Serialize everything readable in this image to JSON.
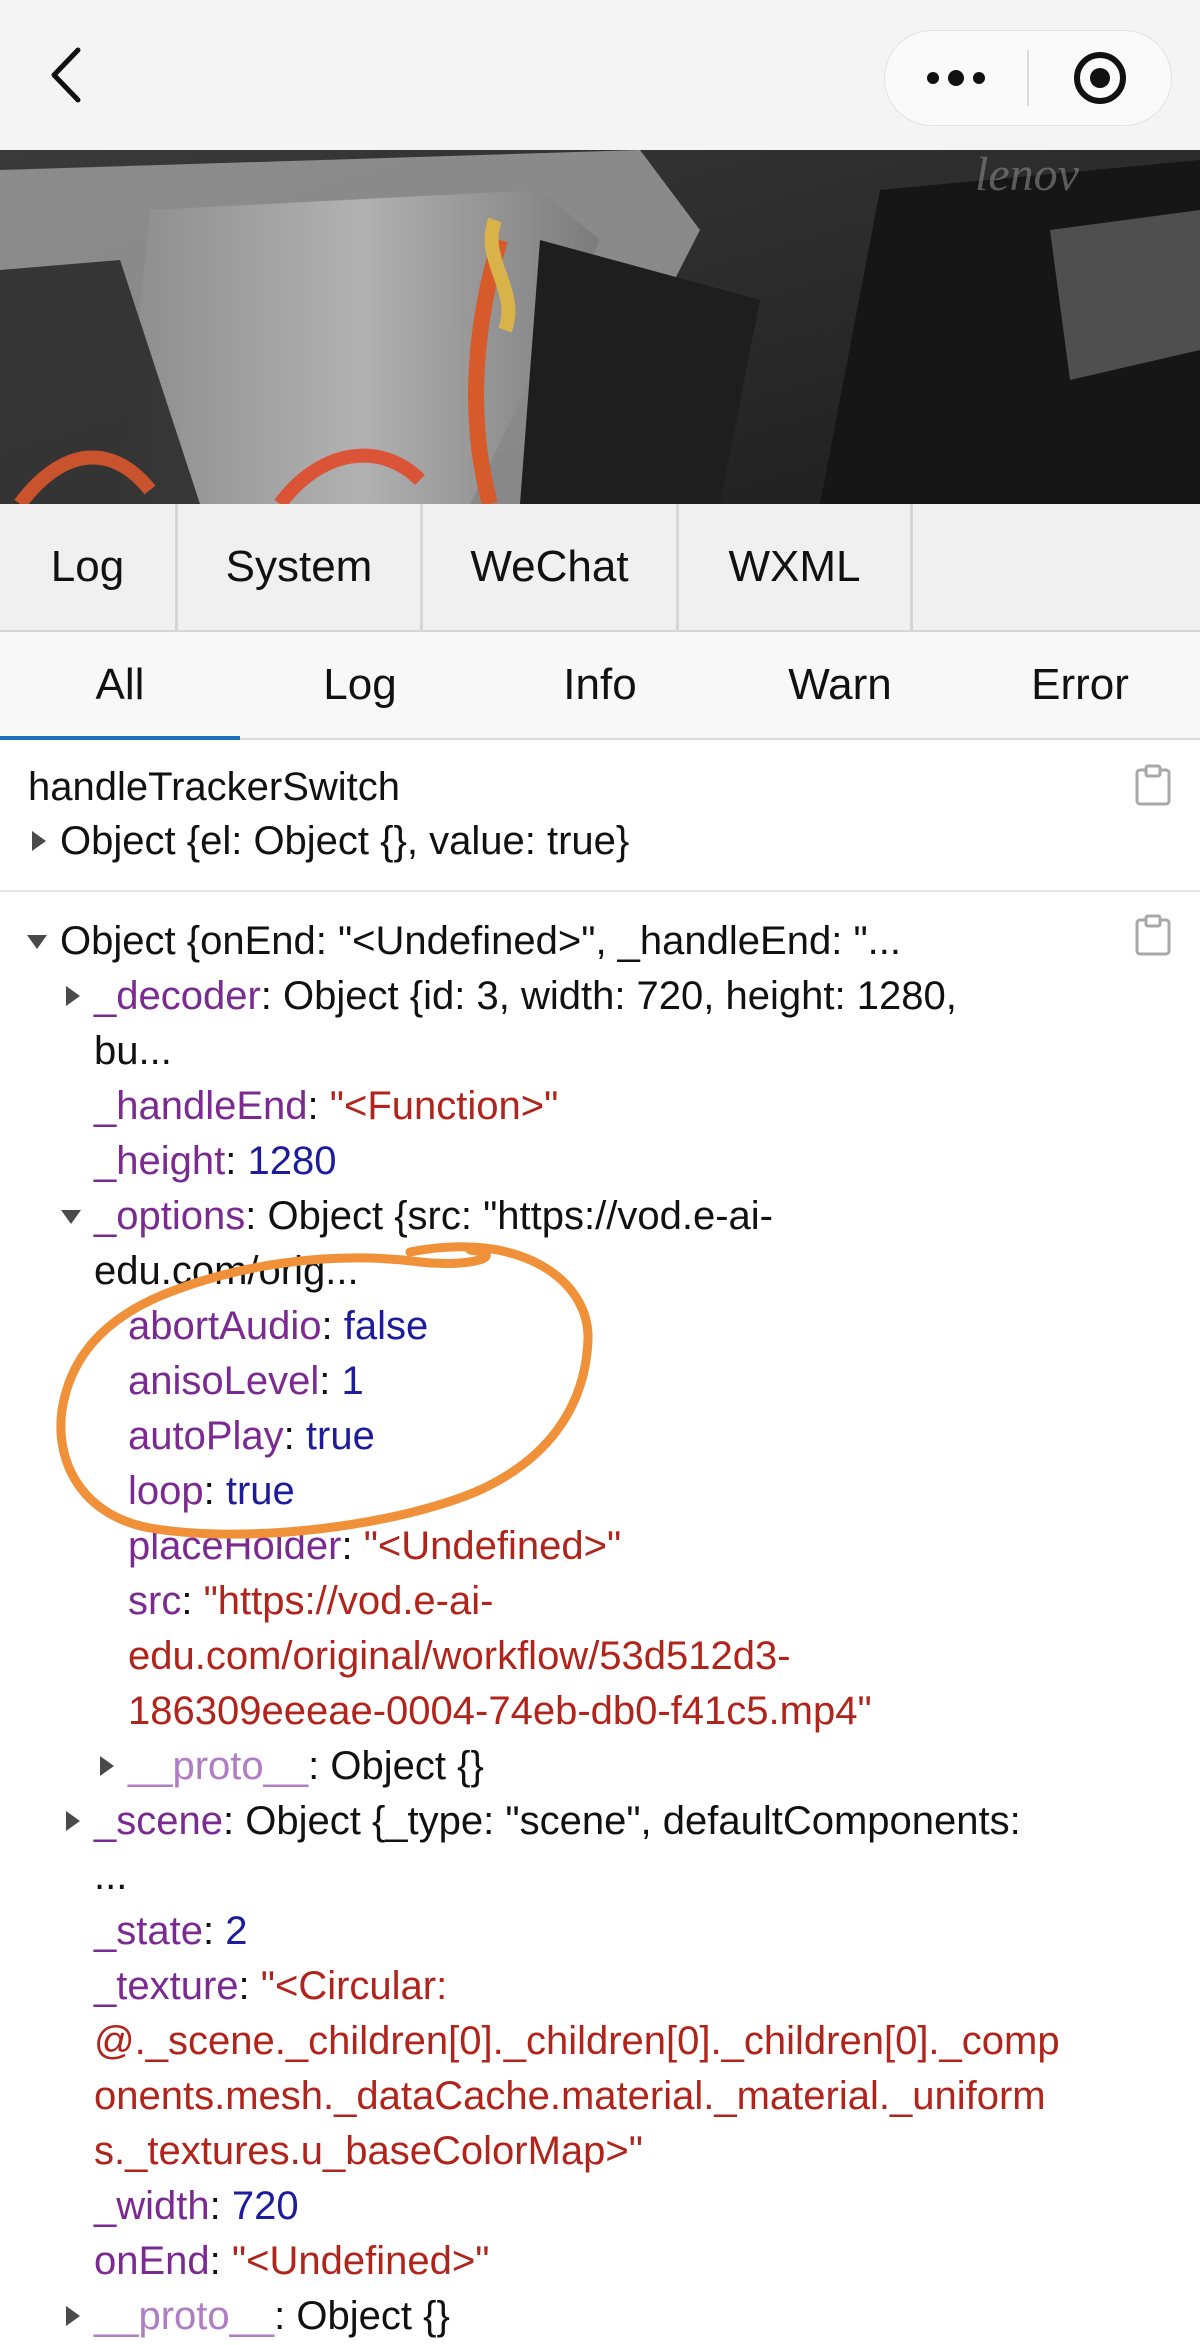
{
  "tabs": [
    "Log",
    "System",
    "WeChat",
    "WXML"
  ],
  "filters": [
    "All",
    "Log",
    "Info",
    "Warn",
    "Error"
  ],
  "entry1": {
    "title": "handleTrackerSwitch",
    "summary": "Object {el: Object {}, value: true}"
  },
  "entry2": {
    "summary": "Object {onEnd: \"<Undefined>\", _handleEnd: \"...",
    "decoder_key": "_decoder",
    "decoder_val_1": "Object {id: 3, width: 720, height: 1280,",
    "decoder_val_2": "bu...",
    "handleEnd_key": "_handleEnd",
    "handleEnd_val": "\"<Function>\"",
    "height_key": "_height",
    "height_val": "1280",
    "options_key": "_options",
    "options_val_1": "Object {src: \"https://vod.e-ai-",
    "options_val_2": "edu.com/orig...",
    "abortAudio_key": "abortAudio",
    "abortAudio_val": "false",
    "anisoLevel_key": "anisoLevel",
    "anisoLevel_val": "1",
    "autoPlay_key": "autoPlay",
    "autoPlay_val": "true",
    "loop_key": "loop",
    "loop_val": "true",
    "placeHolder_key": "placeHolder",
    "placeHolder_val": "\"<Undefined>\"",
    "src_key": "src",
    "src_val_1": "\"https://vod.e-ai-",
    "src_val_2": "edu.com/original/workflow/53d512d3-",
    "src_val_3": "186309eeeae-0004-74eb-db0-f41c5.mp4\"",
    "proto_inner_key": "__proto__",
    "proto_inner_val": "Object {}",
    "scene_key": "_scene",
    "scene_val_1": "Object {_type: \"scene\", defaultComponents:",
    "scene_val_2": "...",
    "state_key": "_state",
    "state_val": "2",
    "texture_key": "_texture",
    "texture_val_1": "\"<Circular:",
    "texture_val_2": "@._scene._children[0]._children[0]._children[0]._comp",
    "texture_val_3": "onents.mesh._dataCache.material._material._uniform",
    "texture_val_4": "s._textures.u_baseColorMap>\"",
    "width_key": "_width",
    "width_val": "720",
    "onEnd_key": "onEnd",
    "onEnd_val": "\"<Undefined>\"",
    "proto_outer_key": "__proto__",
    "proto_outer_val": "Object {}"
  },
  "colors": {
    "key": "#7a2a91",
    "number": "#1c1c9c",
    "string": "#b0241b",
    "annotation": "#f0913a",
    "active_filter": "#1f6fbf"
  }
}
